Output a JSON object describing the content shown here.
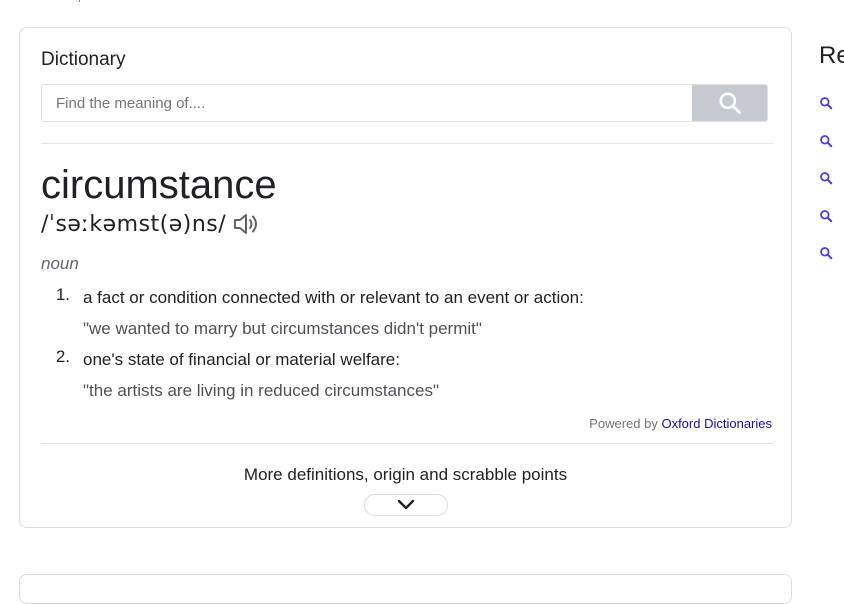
{
  "top_fragment": "— /",
  "dictionary": {
    "title": "Dictionary",
    "search_placeholder": "Find the meaning of....",
    "word": "circumstance",
    "phonetic": "/ˈsəːkəmst(ə)ns/",
    "part_of_speech": "noun",
    "definitions": [
      {
        "number": "1.",
        "text": "a fact or condition connected with or relevant to an event or action:",
        "example": "\"we wanted to marry but circumstances didn't permit\""
      },
      {
        "number": "2.",
        "text": "one's state of financial or material welfare:",
        "example": "\"the artists are living in reduced circumstances\""
      }
    ],
    "powered_by_prefix": "Powered by",
    "powered_by_link": "Oxford Dictionaries",
    "more_label": "More definitions, origin and scrabble points"
  },
  "related": {
    "heading": "Re",
    "icons": [
      "search-icon",
      "search-icon",
      "search-icon",
      "search-icon",
      "search-icon"
    ]
  },
  "colors": {
    "link": "#1a0dab",
    "search_button_bg": "#c5cad1",
    "related_icon": "#4e3bd6"
  },
  "icons": {
    "search_button": "search-icon",
    "pronunciation": "speaker-icon",
    "expand": "chevron-down-icon"
  }
}
